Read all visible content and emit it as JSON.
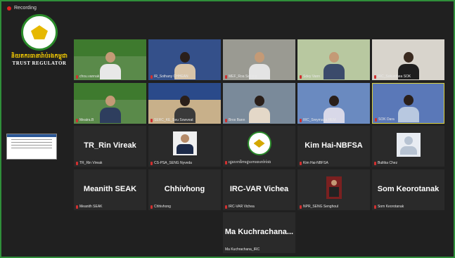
{
  "recording": {
    "label": "Recording"
  },
  "logo": {
    "khmer": "និយតករធានារ៉ាប់រងកម្ពុជា",
    "english": "TRUST REGULATOR"
  },
  "participants": [
    {
      "name": "chou.vannak",
      "type": "video"
    },
    {
      "name": "IR_Sothany CHHEAN",
      "type": "video"
    },
    {
      "name": "MEF_Roa Sellang",
      "type": "video"
    },
    {
      "name": "Sdey Vann",
      "type": "video"
    },
    {
      "name": "IRC_Sokunthea SOK",
      "type": "video"
    },
    {
      "name": "Meatra.B",
      "type": "video"
    },
    {
      "name": "SERC_KE_Seu Sowveat",
      "type": "video"
    },
    {
      "name": "Bros Bann",
      "type": "video"
    },
    {
      "name": "IRC_Sreymana HEM",
      "type": "video"
    },
    {
      "name": "SOK Dara",
      "type": "video"
    },
    {
      "name": "TR_Rin Vireak",
      "type": "name",
      "display": "TR_Rin Vireak"
    },
    {
      "name": "CS-PSA_SENG Nyveda",
      "type": "photo"
    },
    {
      "name": "រដ្ឋលេខាធិការដ្ឋានការធានារ៉ាប់រង",
      "type": "logo"
    },
    {
      "name": "Kim Hai-NBFSA",
      "type": "name",
      "display": "Kim Hai-NBFSA"
    },
    {
      "name": "Bulitka Chez",
      "type": "avatar"
    },
    {
      "name": "Meanith SEAK",
      "type": "name",
      "display": "Meanith SEAK"
    },
    {
      "name": "Chhivhong",
      "type": "name",
      "display": "Chhivhong"
    },
    {
      "name": "IRC-VAR Vichea",
      "type": "name",
      "display": "IRC-VAR Vichea"
    },
    {
      "name": "NPR_SENG Senghoul",
      "type": "portrait"
    },
    {
      "name": "Som Keorotanak",
      "type": "name",
      "display": "Som Keorotanak"
    },
    {
      "name": "Ma Kuchrachana_IRC",
      "type": "name",
      "display": "Ma Kuchrachana..."
    }
  ]
}
